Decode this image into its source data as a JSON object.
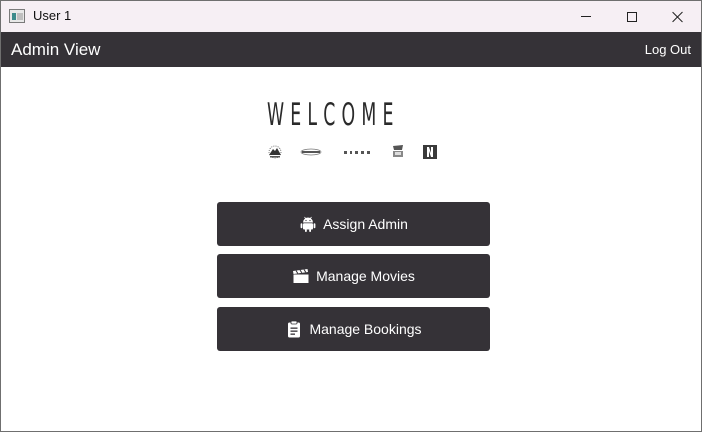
{
  "window": {
    "title": "User 1",
    "controls": {
      "minimize": "minimize",
      "maximize": "maximize",
      "close": "close"
    }
  },
  "header": {
    "title": "Admin View",
    "logout_label": "Log Out"
  },
  "welcome": {
    "heading": "WELCOME",
    "logos": [
      "paramount-logo",
      "universal-logo",
      "pixar-logo",
      "warner-bros-logo",
      "netflix-logo"
    ]
  },
  "menu": {
    "assign_admin": {
      "label": "Assign Admin",
      "icon": "android-icon"
    },
    "manage_movies": {
      "label": "Manage Movies",
      "icon": "clapperboard-icon"
    },
    "manage_bookings": {
      "label": "Manage Bookings",
      "icon": "clipboard-icon"
    }
  },
  "colors": {
    "header_bg": "#353237",
    "button_bg": "#353237",
    "titlebar_bg": "#f6eff4",
    "text_light": "#ffffff"
  }
}
